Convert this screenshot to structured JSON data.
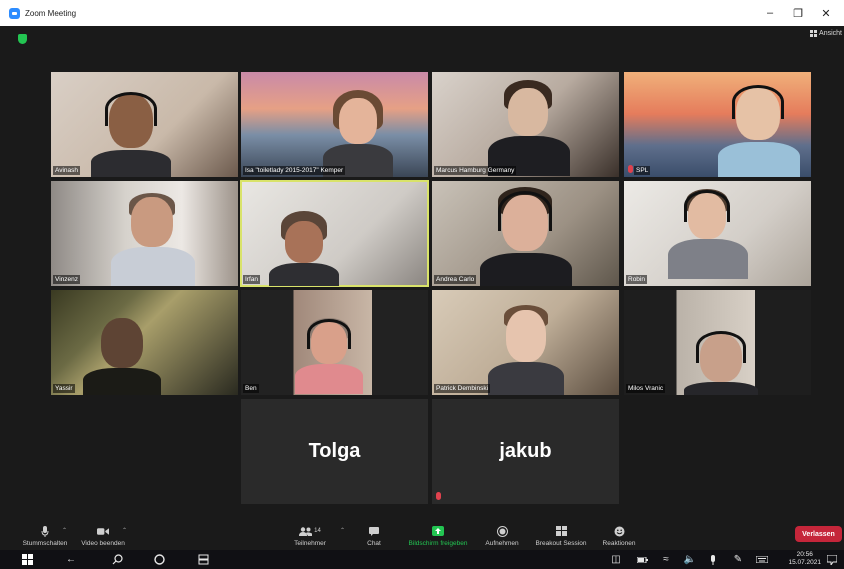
{
  "window": {
    "title": "Zoom Meeting",
    "controls": [
      "minimize-icon",
      "restore-icon",
      "close-icon"
    ]
  },
  "header": {
    "view_label": "Ansicht"
  },
  "participants": [
    {
      "name": "Avinash"
    },
    {
      "name": "Isa \"toiletlady 2015-2017\" Kemper"
    },
    {
      "name": "Marcus Hamburg Germany"
    },
    {
      "name": "SPL"
    },
    {
      "name": "Vinzenz"
    },
    {
      "name": "Irfan"
    },
    {
      "name": "Andrea Carlo"
    },
    {
      "name": "Robin"
    },
    {
      "name": "Yassir"
    },
    {
      "name": "Ben"
    },
    {
      "name": "Patrick Dembinski"
    },
    {
      "name": "Milos Vranic"
    },
    {
      "name": "Tolga"
    },
    {
      "name": "jakub"
    }
  ],
  "toolbar": {
    "mute_label": "Stummschalten",
    "video_label": "Video beenden",
    "participants_label": "Teilnehmer",
    "participants_count": "14",
    "chat_label": "Chat",
    "share_label": "Bildschirm freigeben",
    "record_label": "Aufnehmen",
    "breakout_label": "Breakout Session",
    "reactions_label": "Reaktionen",
    "leave_label": "Verlassen"
  },
  "taskbar": {
    "time": "20:56",
    "date": "15.07.2021"
  },
  "colors": {
    "accent_blue": "#2d8cff",
    "share_green": "#23c552",
    "leave_red": "#c5263a",
    "active_speaker": "#d9e36a"
  }
}
